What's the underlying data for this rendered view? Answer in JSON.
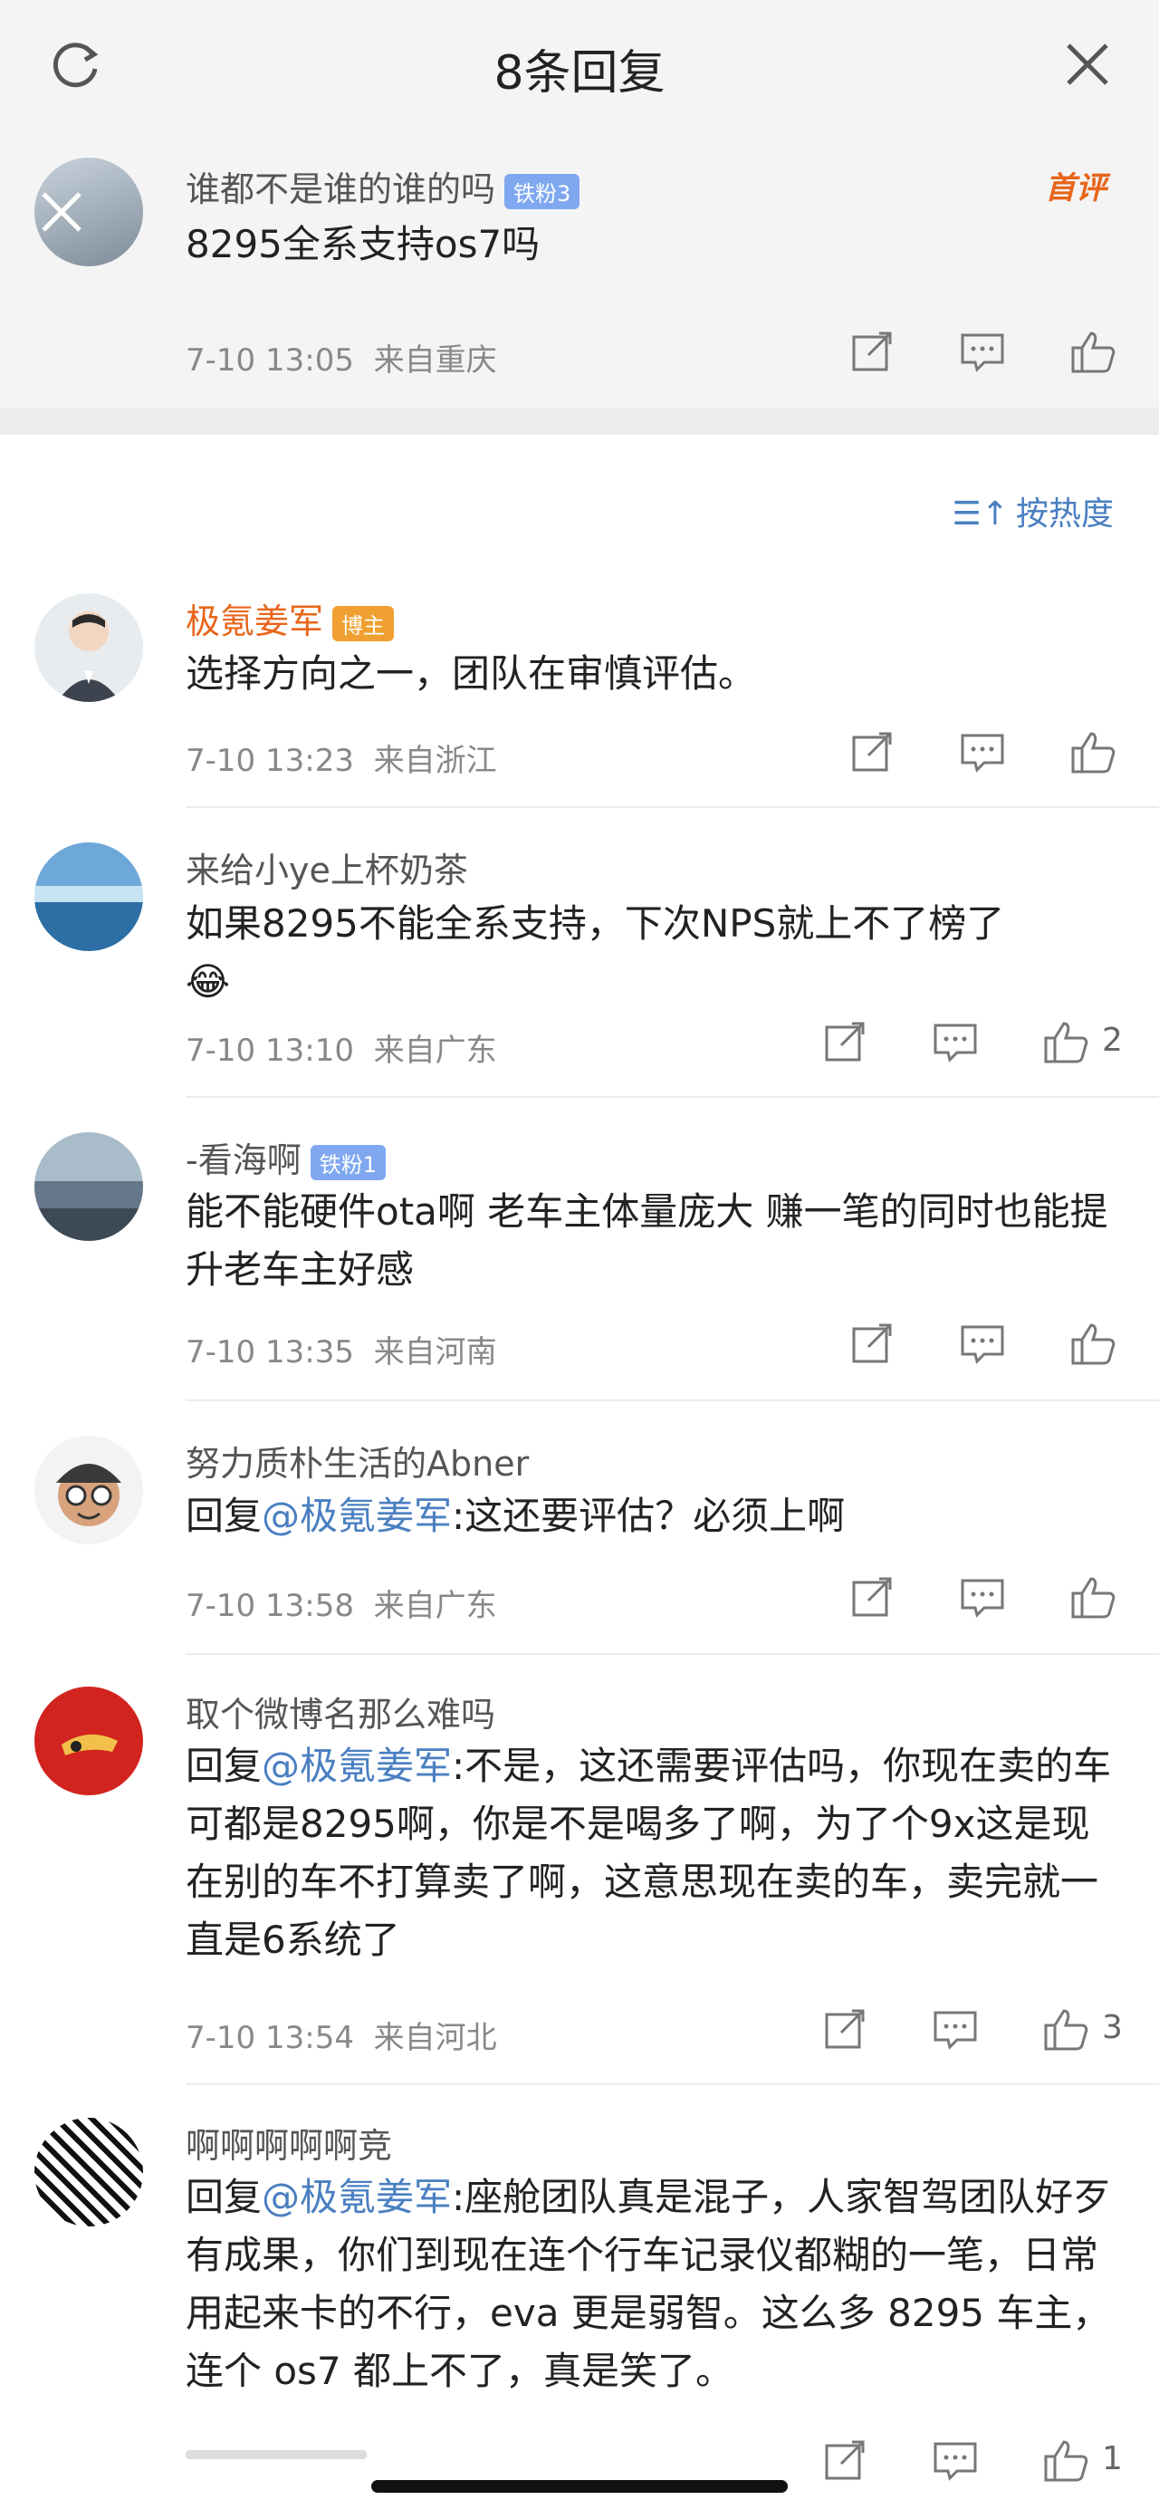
{
  "header": {
    "title": "8条回复"
  },
  "main_comment": {
    "user": "谁都不是谁的谁的吗",
    "badge": "铁粉3",
    "tag": "首评",
    "text": "8295全系支持os7吗",
    "time": "7-10 13:05",
    "location": "来自重庆"
  },
  "sort": {
    "label": "按热度"
  },
  "replies": [
    {
      "user": "极氪姜军",
      "badge": "博主",
      "badge_type": "gold",
      "text": "选择方向之一，团队在审慎评估。",
      "time": "7-10 13:23",
      "location": "来自浙江",
      "likes": ""
    },
    {
      "user": "来给小ye上杯奶茶",
      "badge": "",
      "text": "如果8295不能全系支持，下次NPS就上不了榜了",
      "emoji": "😂",
      "time": "7-10 13:10",
      "location": "来自广东",
      "likes": "2"
    },
    {
      "user": "-看海啊",
      "badge": "铁粉1",
      "text": "能不能硬件ota啊 老车主体量庞大 赚一笔的同时也能提升老车主好感",
      "time": "7-10 13:35",
      "location": "来自河南",
      "likes": ""
    },
    {
      "user": "努力质朴生活的Abner",
      "badge": "",
      "reply_prefix": "回复",
      "mention": "@极氪姜军",
      "text": ":这还要评估？必须上啊",
      "time": "7-10 13:58",
      "location": "来自广东",
      "likes": ""
    },
    {
      "user": "取个微博名那么难吗",
      "badge": "",
      "reply_prefix": "回复",
      "mention": "@极氪姜军",
      "text": ":不是，这还需要评估吗，你现在卖的车可都是8295啊，你是不是喝多了啊，为了个9x这是现在别的车不打算卖了啊，这意思现在卖的车，卖完就一直是6系统了",
      "time": "7-10 13:54",
      "location": "来自河北",
      "likes": "3"
    },
    {
      "user": "啊啊啊啊啊竞",
      "badge": "",
      "reply_prefix": "回复",
      "mention": "@极氪姜军",
      "text": ":座舱团队真是混子，人家智驾团队好歹有成果，你们到现在连个行车记录仪都糊的一笔，日常用起来卡的不行，eva 更是弱智。这么多 8295 车主，连个 os7 都上不了，真是笑了。",
      "likes": "1"
    }
  ],
  "colors": {
    "accent": "#4a7fc1",
    "orange": "#e8651a",
    "header_bg": "#f4f4f4"
  },
  "icons": [
    "refresh-icon",
    "close-icon",
    "share-icon",
    "comment-icon",
    "like-icon",
    "sort-icon"
  ]
}
